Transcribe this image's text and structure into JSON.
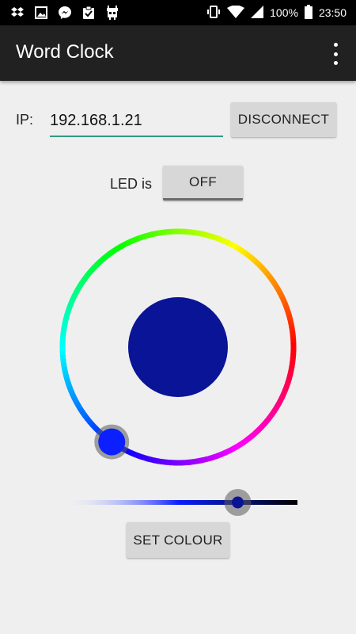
{
  "status_bar": {
    "battery": "100%",
    "time": "23:50",
    "notification_icons": [
      "dropbox-icon",
      "image-icon",
      "messenger-icon",
      "clipboard-check-icon",
      "android-icon"
    ],
    "system_icons": [
      "vibrate-icon",
      "wifi-icon",
      "signal-icon",
      "battery-icon"
    ]
  },
  "app_bar": {
    "title": "Word Clock",
    "menu_icon": "more-vert-icon"
  },
  "connection": {
    "ip_label": "IP:",
    "ip_value": "192.168.1.21",
    "disconnect_label": "DISCONNECT"
  },
  "led": {
    "label": "LED is",
    "toggle_label": "OFF"
  },
  "color_picker": {
    "selected_color": "#0a1496",
    "hue_handle_color": "#0b1fff",
    "hue_degrees": 235,
    "brightness": 0.75
  },
  "actions": {
    "set_colour_label": "SET COLOUR"
  },
  "colors": {
    "app_bar": "#212121",
    "status_bar": "#000000",
    "background": "#efefef",
    "input_underline": "#2f9a86",
    "button": "#d7d7d7"
  }
}
